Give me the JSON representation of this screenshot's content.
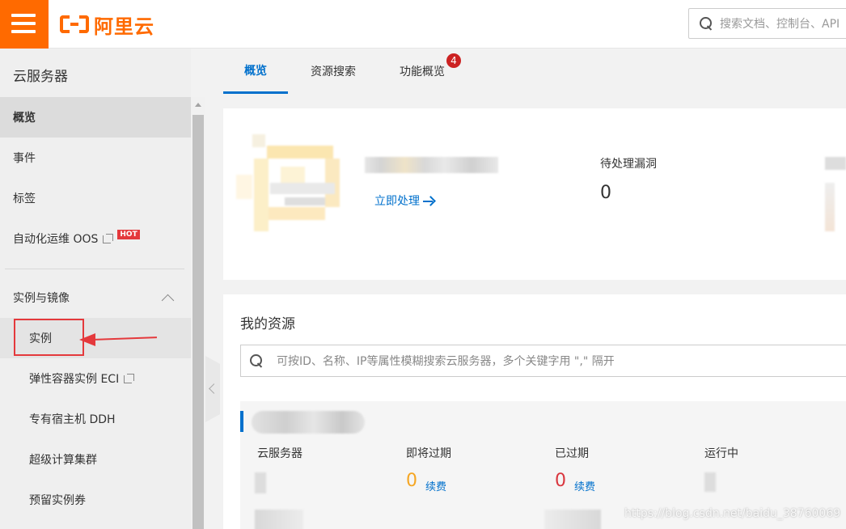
{
  "brand": {
    "name": "阿里云",
    "color": "#ff6a00"
  },
  "top_search": {
    "placeholder": "搜索文档、控制台、API"
  },
  "sidebar": {
    "title": "云服务器",
    "items": [
      {
        "label": "概览",
        "active": true
      },
      {
        "label": "事件"
      },
      {
        "label": "标签"
      },
      {
        "label": "自动化运维 OOS",
        "external": true,
        "badge": "HOT"
      }
    ],
    "group": {
      "label": "实例与镜像",
      "items": [
        {
          "label": "实例",
          "highlighted": true
        },
        {
          "label": "弹性容器实例 ECI",
          "external": true
        },
        {
          "label": "专有宿主机 DDH"
        },
        {
          "label": "超级计算集群"
        },
        {
          "label": "预留实例券"
        }
      ]
    }
  },
  "tabs": [
    {
      "label": "概览",
      "active": true
    },
    {
      "label": "资源搜索"
    },
    {
      "label": "功能概览",
      "badge": "4"
    }
  ],
  "overview": {
    "action_link": "立即处理",
    "vuln_label": "待处理漏洞",
    "vuln_value": "0"
  },
  "resources": {
    "title": "我的资源",
    "search_placeholder": "可按ID、名称、IP等属性模糊搜索云服务器，多个关键字用 \",\" 隔开",
    "columns": [
      {
        "label": "云服务器"
      },
      {
        "label": "即将过期",
        "value": "0",
        "link": "续费"
      },
      {
        "label": "已过期",
        "value": "0",
        "link": "续费"
      },
      {
        "label": "运行中"
      }
    ]
  },
  "watermark": "https://blog.csdn.net/baidu_38760069",
  "colors": {
    "accent": "#0070cc",
    "alert": "#e4393c"
  }
}
